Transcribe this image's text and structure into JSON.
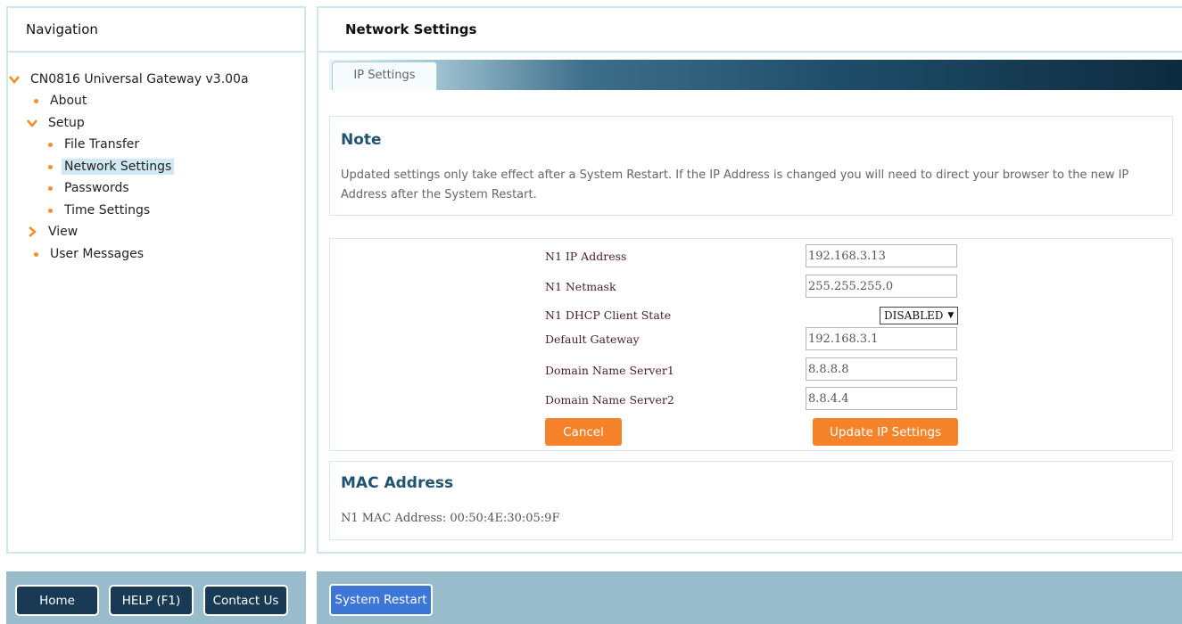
{
  "nav": {
    "title": "Navigation",
    "items": [
      {
        "label": "CN0816 Universal Gateway v3.00a",
        "icon": "chevron-down-icon"
      },
      {
        "label": "About",
        "icon": "bullet-icon"
      },
      {
        "label": "Setup",
        "icon": "chevron-down-icon"
      },
      {
        "label": "File Transfer",
        "icon": "bullet-icon"
      },
      {
        "label": "Network Settings",
        "icon": "bullet-icon",
        "selected": true
      },
      {
        "label": "Passwords",
        "icon": "bullet-icon"
      },
      {
        "label": "Time Settings",
        "icon": "bullet-icon"
      },
      {
        "label": "View",
        "icon": "chevron-right-icon"
      },
      {
        "label": "User Messages",
        "icon": "bullet-icon"
      }
    ]
  },
  "main": {
    "title": "Network Settings",
    "tabs": [
      {
        "label": "IP Settings",
        "active": true
      }
    ],
    "note": {
      "heading": "Note",
      "text": "Updated settings only take effect after a System Restart. If the IP Address is changed you will need to direct your browser to the new IP Address after the System Restart."
    },
    "form": {
      "ip_label": "N1 IP Address",
      "ip_value": "192.168.3.13",
      "netmask_label": "N1 Netmask",
      "netmask_value": "255.255.255.0",
      "dhcp_label": "N1 DHCP Client State",
      "dhcp_value": "DISABLED",
      "gateway_label": "Default Gateway",
      "gateway_value": "192.168.3.1",
      "dns1_label": "Domain Name Server1",
      "dns1_value": "8.8.8.8",
      "dns2_label": "Domain Name Server2",
      "dns2_value": "8.8.4.4",
      "cancel_label": "Cancel",
      "update_label": "Update IP Settings"
    },
    "mac": {
      "heading": "MAC Address",
      "text": "N1 MAC Address: 00:50:4E:30:05:9F"
    }
  },
  "footer": {
    "home_label": "Home",
    "help_label": "HELP (F1)",
    "contact_label": "Contact Us",
    "restart_label": "System Restart"
  },
  "colors": {
    "accent_orange": "#f6832a",
    "heading_blue": "#1f5474",
    "footer_bg": "#99bccc",
    "dark_button": "#183a54",
    "restart_button": "#3c76d6"
  }
}
